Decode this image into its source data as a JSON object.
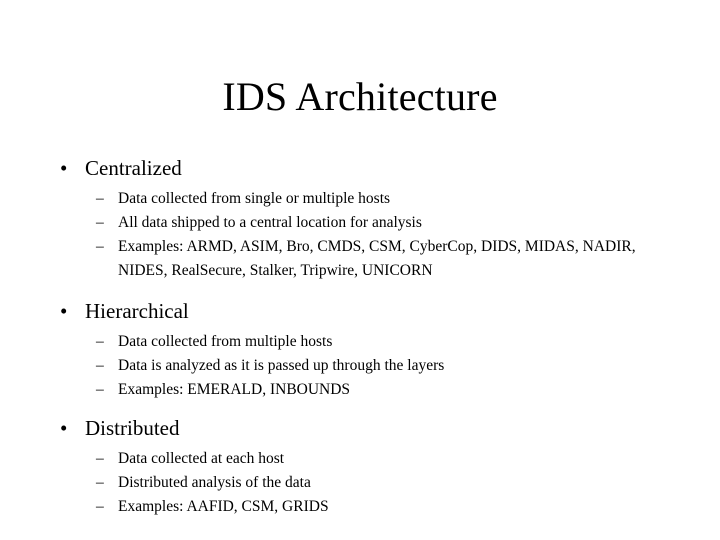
{
  "slide": {
    "title": "IDS Architecture",
    "bullet_glyph": "•",
    "dash_glyph": "–",
    "text_color": "#000000",
    "background_color": "#ffffff",
    "sections": [
      {
        "heading": "Centralized",
        "items": [
          "Data collected from single or multiple hosts",
          "All data shipped to a central location for analysis",
          "Examples: ARMD, ASIM, Bro, CMDS, CSM, CyberCop, DIDS, MIDAS, NADIR, NIDES, RealSecure, Stalker, Tripwire, UNICORN"
        ]
      },
      {
        "heading": "Hierarchical",
        "items": [
          "Data collected from multiple hosts",
          "Data is analyzed as it is passed up through the layers",
          "Examples: EMERALD, INBOUNDS"
        ]
      },
      {
        "heading": "Distributed",
        "items": [
          "Data collected at each host",
          "Distributed analysis of the data",
          "Examples: AAFID, CSM, GRIDS"
        ]
      }
    ]
  }
}
